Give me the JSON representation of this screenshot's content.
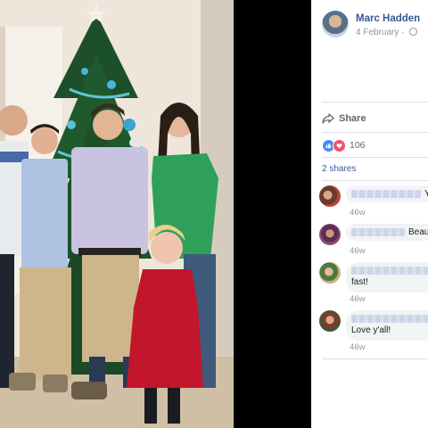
{
  "post": {
    "author_name": "Marc Hadden",
    "date": "4 February",
    "share_label": "Share",
    "reaction_count": "106",
    "shares_label": "2 shares"
  },
  "comments": [
    {
      "text": "Y",
      "time": "46w"
    },
    {
      "text": "Beau",
      "time": "46w"
    },
    {
      "text": "fast!",
      "time": "46w"
    },
    {
      "text": "Love y'all!",
      "time": "46w"
    }
  ],
  "icons": {
    "share": "share-arrow-icon",
    "like": "like-thumb-icon",
    "love": "love-heart-icon",
    "privacy": "globe-icon"
  },
  "colors": {
    "link": "#385898",
    "meta": "#90949c",
    "like": "#4a8bf5",
    "love": "#f0516b",
    "tree": "#1f5a2e",
    "green_top": "#2ea05a",
    "red_dress": "#c2162b"
  }
}
